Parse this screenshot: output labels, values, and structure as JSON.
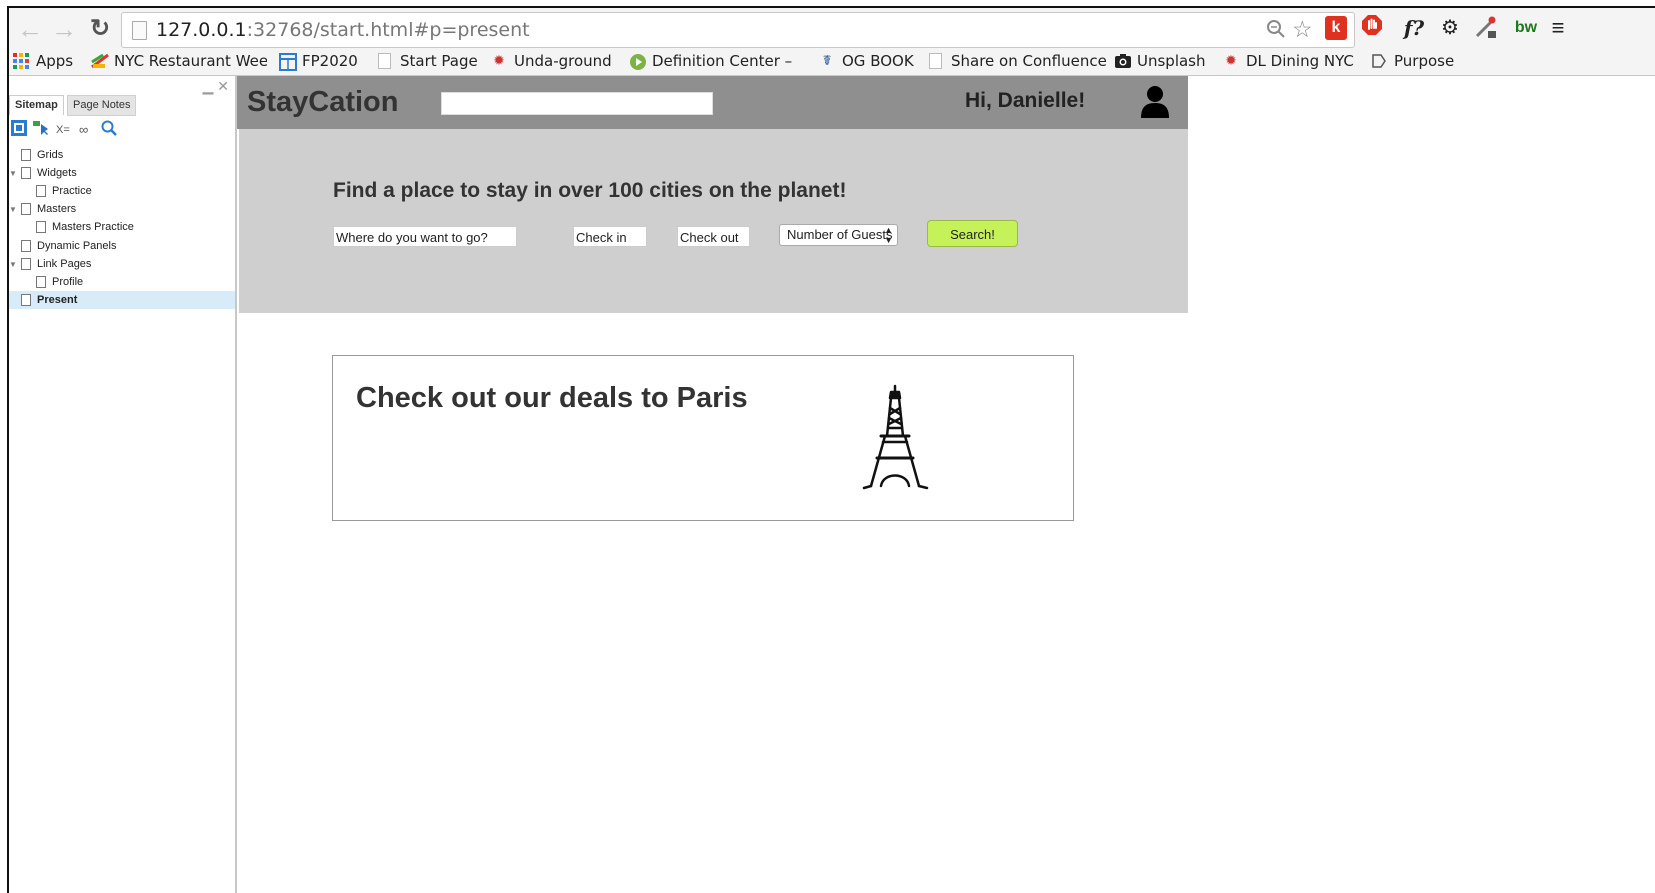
{
  "browser": {
    "url_host": "127.0.0.1",
    "url_rest": ":32768/start.html#p=present",
    "extensions": [
      "zoom-icon",
      "star-icon",
      "k",
      "adblock-icon",
      "f?",
      "gear-icon",
      "eyedropper-icon",
      "bw",
      "menu-icon"
    ],
    "extension_labels": {
      "k": "k",
      "f": "f?",
      "bw": "bw"
    }
  },
  "bookmarks": [
    {
      "label": "Apps",
      "icon": "apps-grid-icon"
    },
    {
      "label": "NYC Restaurant Wee",
      "icon": "restaurant-icon"
    },
    {
      "label": "FP2020",
      "icon": "trello-icon"
    },
    {
      "label": "Start Page",
      "icon": "page-icon"
    },
    {
      "label": "Unda-ground",
      "icon": "pin-icon"
    },
    {
      "label": "Definition Center – L",
      "icon": "play-circle-icon"
    },
    {
      "label": "OG BOOK",
      "icon": "ribbon-icon"
    },
    {
      "label": "Share on Confluence",
      "icon": "page-icon"
    },
    {
      "label": "Unsplash",
      "icon": "camera-icon"
    },
    {
      "label": "DL Dining NYC",
      "icon": "pin-icon"
    },
    {
      "label": "Purpose",
      "icon": "tag-icon"
    }
  ],
  "sitemap": {
    "tabs": [
      "Sitemap",
      "Page Notes"
    ],
    "tools": [
      "X="
    ],
    "nodes": [
      {
        "label": "Grids",
        "level": 0,
        "expanded": false
      },
      {
        "label": "Widgets",
        "level": 0,
        "expanded": true
      },
      {
        "label": "Practice",
        "level": 1,
        "expanded": false
      },
      {
        "label": "Masters",
        "level": 0,
        "expanded": true
      },
      {
        "label": "Masters Practice",
        "level": 1,
        "expanded": false
      },
      {
        "label": "Dynamic Panels",
        "level": 0,
        "expanded": false
      },
      {
        "label": "Link Pages",
        "level": 0,
        "expanded": true
      },
      {
        "label": "Profile",
        "level": 1,
        "expanded": false
      },
      {
        "label": "Present",
        "level": 0,
        "expanded": false,
        "selected": true
      }
    ]
  },
  "site": {
    "logo": "StayCation",
    "greeting": "Hi, Danielle!",
    "hero_title": "Find a place to stay in over 100 cities on the planet!",
    "where_placeholder": "Where do you want to go?",
    "check_in": "Check in",
    "check_out": "Check out",
    "guests_selected": "Number of Guests",
    "search_button": "Search!",
    "deal_title": "Check out our deals to Paris"
  },
  "colors": {
    "header_bg": "#8f8f8f",
    "hero_bg": "#cfcfcf",
    "search_btn": "#c6f259",
    "selected_node": "#d7ecf8"
  }
}
